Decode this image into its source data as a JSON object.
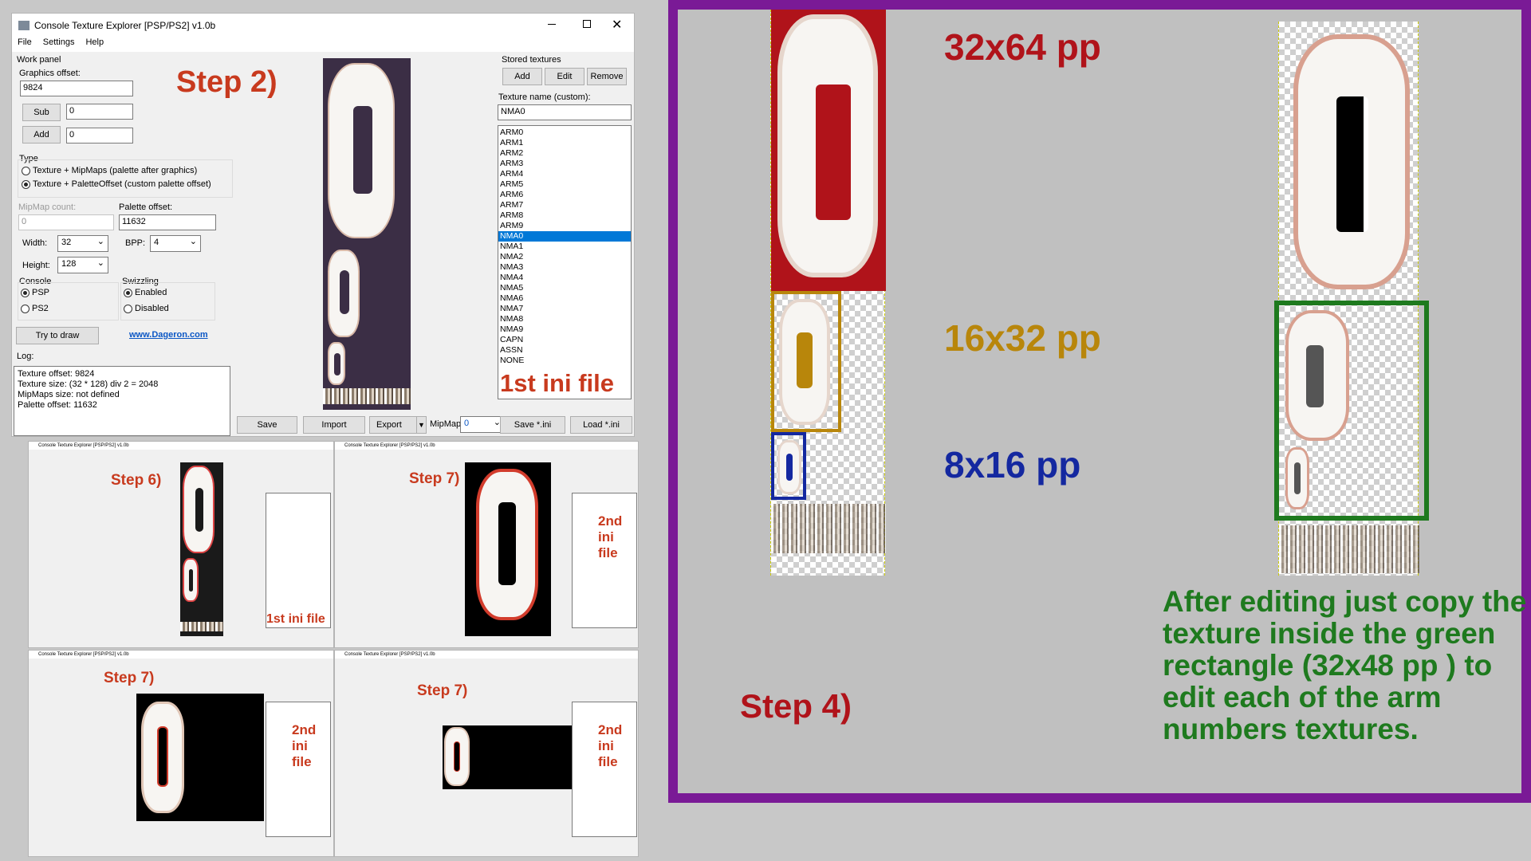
{
  "app": {
    "title": "Console Texture Explorer [PSP/PS2] v1.0b",
    "menu": [
      "File",
      "Settings",
      "Help"
    ]
  },
  "work_panel": {
    "label": "Work panel",
    "graphics_offset_label": "Graphics offset:",
    "graphics_offset": "9824",
    "sub_label": "Sub",
    "sub_value": "0",
    "add_label": "Add",
    "add_value": "0",
    "type_label": "Type",
    "type_opt1": "Texture + MipMaps (palette after graphics)",
    "type_opt2": "Texture + PaletteOffset (custom palette offset)",
    "mipmap_count_label": "MipMap count:",
    "mipmap_count": "0",
    "palette_offset_label": "Palette offset:",
    "palette_offset": "11632",
    "width_label": "Width:",
    "width": "32",
    "bpp_label": "BPP:",
    "bpp": "4",
    "height_label": "Height:",
    "height": "128",
    "console_label": "Console",
    "console_psp": "PSP",
    "console_ps2": "PS2",
    "swizzling_label": "Swizzling",
    "swz_enabled": "Enabled",
    "swz_disabled": "Disabled",
    "try_draw": "Try to draw",
    "link": "www.Dageron.com",
    "log_label": "Log:",
    "log": [
      "Texture offset: 9824",
      "Texture size: (32 * 128) div 2 = 2048",
      "MipMaps size: not defined",
      "Palette offset: 11632"
    ]
  },
  "bottom_bar": {
    "save": "Save",
    "import": "Import",
    "export": "Export",
    "mipmap_label": "MipMap:",
    "mipmap_value": "0"
  },
  "stored": {
    "label": "Stored textures",
    "add": "Add",
    "edit": "Edit",
    "remove": "Remove",
    "name_label": "Texture name (custom):",
    "name_value": "NMA0",
    "items": [
      "ARM0",
      "ARM1",
      "ARM2",
      "ARM3",
      "ARM4",
      "ARM5",
      "ARM6",
      "ARM7",
      "ARM8",
      "ARM9",
      "NMA0",
      "NMA1",
      "NMA2",
      "NMA3",
      "NMA4",
      "NMA5",
      "NMA6",
      "NMA7",
      "NMA8",
      "NMA9",
      "CAPN",
      "ASSN",
      "NONE"
    ],
    "selected": "NMA0",
    "save_ini": "Save *.ini",
    "load_ini": "Load *.ini"
  },
  "annotations": {
    "step2": "Step 2)",
    "first_ini": "1st ini file",
    "step6": "Step 6)",
    "step7": "Step 7)",
    "first_ini_small": "1st ini file",
    "second_ini": [
      "2nd",
      "ini",
      "file"
    ],
    "size_32x64": "32x64 pp",
    "size_16x32": "16x32 pp",
    "size_8x16": "8x16 pp",
    "step4": "Step 4)",
    "note": [
      "After editing just copy the",
      "texture inside the green",
      "rectangle (32x48 pp ) to",
      "edit each of the arm",
      "numbers textures."
    ]
  },
  "colors": {
    "red_note": "#c83a1e",
    "dark_red": "#b0131a",
    "gold": "#b8860b",
    "blue": "#1428a0",
    "green": "#1e7a1e",
    "purple": "#7a1a96"
  }
}
